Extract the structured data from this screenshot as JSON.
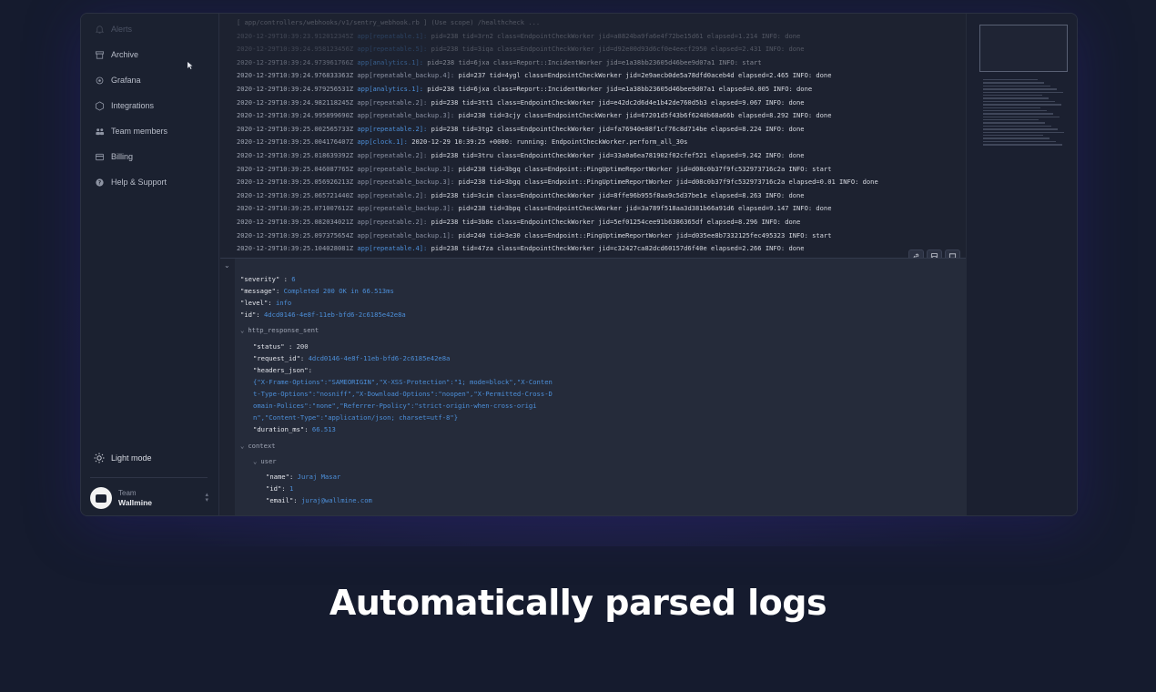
{
  "headline": "Automatically parsed logs",
  "sidebar": {
    "items": [
      {
        "label": "Alerts",
        "icon": "bell-icon",
        "dim": true
      },
      {
        "label": "Archive",
        "icon": "archive-icon",
        "dim": false
      },
      {
        "label": "Grafana",
        "icon": "grafana-icon",
        "dim": false
      },
      {
        "label": "Integrations",
        "icon": "integrations-icon",
        "dim": false
      },
      {
        "label": "Team members",
        "icon": "team-members-icon",
        "dim": false
      },
      {
        "label": "Billing",
        "icon": "billing-icon",
        "dim": false
      },
      {
        "label": "Help & Support",
        "icon": "help-icon",
        "dim": false
      }
    ],
    "light_mode": "Light mode",
    "team_label": "Team",
    "team_name": "Wallmine"
  },
  "logs": [
    {
      "ts": "",
      "app": "",
      "msg": "[ app/controllers/webhooks/v1/sentry_webhook.rb ] (Use scope) /healthcheck ...",
      "faded": true,
      "blue": false
    },
    {
      "ts": "2020-12-29T10:39:23.912012345Z",
      "app": "app[repeatable.1]:",
      "msg": "pid=238 tid=3rn2 class=EndpointCheckWorker jid=a8824ba9fa6e4f72be15d61 elapsed=1.214 INFO: done",
      "faded": true,
      "blue": true
    },
    {
      "ts": "2020-12-29T10:39:24.958123456Z",
      "app": "app[repeatable.5]:",
      "msg": "pid=238 tid=3iqa class=EndpointCheckWorker jid=d92e00d93d6cf0e4eecf2950 elapsed=2.431 INFO: done",
      "faded": true,
      "blue": true
    },
    {
      "ts": "2020-12-29T10:39:24.973961766Z",
      "app": "app[analytics.1]:",
      "msg": "pid=238 tid=6jxa class=Report::IncidentWorker jid=e1a38bb23605d46bee9d07a1 INFO: start",
      "faded": false,
      "semi": true,
      "blue": true
    },
    {
      "ts": "2020-12-29T10:39:24.976833363Z",
      "app": "app[repeatable_backup.4]:",
      "msg": "pid=237 tid=4ygl class=EndpointCheckWorker jid=2e9aecb0de5a78dfd0aceb4d elapsed=2.465 INFO: done",
      "faded": false,
      "blue": false
    },
    {
      "ts": "2020-12-29T10:39:24.979256531Z",
      "app": "app[analytics.1]:",
      "msg": "pid=238 tid=6jxa class=Report::IncidentWorker jid=e1a38bb23605d46bee9d07a1 elapsed=0.005 INFO: done",
      "faded": false,
      "blue": true
    },
    {
      "ts": "2020-12-29T10:39:24.982118245Z",
      "app": "app[repeatable.2]:",
      "msg": "pid=238 tid=3tt1 class=EndpointCheckWorker jid=e42dc2d6d4e1b42de760d5b3 elapsed=9.067 INFO: done",
      "faded": false,
      "blue": false
    },
    {
      "ts": "2020-12-29T10:39:24.995899690Z",
      "app": "app[repeatable_backup.3]:",
      "msg": "pid=238 tid=3cjy class=EndpointCheckWorker jid=67201d5f43b6f6240b68a66b elapsed=8.292 INFO: done",
      "faded": false,
      "blue": false
    },
    {
      "ts": "2020-12-29T10:39:25.002565733Z",
      "app": "app[repeatable.2]:",
      "msg": "pid=238 tid=3tg2 class=EndpointCheckWorker jid=fa76940e88f1cf76c8d714be elapsed=8.224 INFO: done",
      "faded": false,
      "blue": true
    },
    {
      "ts": "2020-12-29T10:39:25.004176407Z",
      "app": "app[clock.1]:",
      "msg": "2020-12-29 10:39:25 +0000: running: EndpointCheckWorker.perform_all_30s",
      "faded": false,
      "blue": true
    },
    {
      "ts": "2020-12-29T10:39:25.018639392Z",
      "app": "app[repeatable.2]:",
      "msg": "pid=238 tid=3tru class=EndpointCheckWorker jid=33a0a6ea781902f02cfef521 elapsed=9.242 INFO: done",
      "faded": false,
      "blue": false
    },
    {
      "ts": "2020-12-29T10:39:25.046087765Z",
      "app": "app[repeatable_backup.3]:",
      "msg": "pid=238 tid=3bgq class=Endpoint::PingUptimeReportWorker jid=d08c0b37f9fc532973716c2a INFO: start",
      "faded": false,
      "blue": false
    },
    {
      "ts": "2020-12-29T10:39:25.056926213Z",
      "app": "app[repeatable_backup.3]:",
      "msg": "pid=238 tid=3bgq class=Endpoint::PingUptimeReportWorker jid=d08c0b37f9fc532973716c2a elapsed=0.01 INFO: done",
      "faded": false,
      "blue": false
    },
    {
      "ts": "2020-12-29T10:39:25.065721440Z",
      "app": "app[repeatable.2]:",
      "msg": "pid=238 tid=3cim class=EndpointCheckWorker jid=8ffe96b955f8aa9c5d37be1e elapsed=8.263 INFO: done",
      "faded": false,
      "blue": false
    },
    {
      "ts": "2020-12-29T10:39:25.071007612Z",
      "app": "app[repeatable_backup.3]:",
      "msg": "pid=238 tid=3bpq class=EndpointCheckWorker jid=3a789f518aa3d381b66a91d6 elapsed=9.147 INFO: done",
      "faded": false,
      "blue": false
    },
    {
      "ts": "2020-12-29T10:39:25.082034021Z",
      "app": "app[repeatable.2]:",
      "msg": "pid=238 tid=3b8e class=EndpointCheckWorker jid=5ef01254cee91b6386365df elapsed=8.296 INFO: done",
      "faded": false,
      "blue": false
    },
    {
      "ts": "2020-12-29T10:39:25.097375654Z",
      "app": "app[repeatable_backup.1]:",
      "msg": "pid=240 tid=3e30 class=Endpoint::PingUptimeReportWorker jid=d035ee8b7332125fec495323 INFO: start",
      "faded": false,
      "blue": false
    },
    {
      "ts": "2020-12-29T10:39:25.104028081Z",
      "app": "app[repeatable.4]:",
      "msg": "pid=238 tid=47za class=EndpointCheckWorker jid=c32427ca82dcd60157d6f40e elapsed=2.266 INFO: done",
      "faded": false,
      "blue": true
    }
  ],
  "toolbar": {
    "link_icon": "link-icon",
    "save_icon": "save-icon",
    "comment_icon": "comment-icon"
  },
  "detail": {
    "severity_key": "\"severity\" :",
    "severity_val": "6",
    "message_key": "\"message\":",
    "message_val": "Completed 200 OK in 66.513ms",
    "level_key": "\"level\":",
    "level_val": "info",
    "id_key": "\"id\":",
    "id_val": "4dcd0146-4e8f-11eb-bfd6-2c6185e42e8a",
    "http_section": "http_response_sent",
    "status_key": "\"status\" :",
    "status_val": "200",
    "request_id_key": "\"request_id\":",
    "request_id_val": "4dcd0146-4e8f-11eb-bfd6-2c6185e42e8a",
    "headers_key": "\"headers_json\":",
    "headers_lines": [
      "{\"X-Frame-Options\":\"SAMEORIGIN\",\"X-XSS-Protection\":\"1; mode=block\",\"X-Conten",
      "t-Type-Options\":\"nosniff\",\"X-Download-Options\":\"noopen\",\"X-Permitted-Cross-D",
      "omain-Polices\":\"none\",\"Referrer-Ppolicy\":\"strict-origin-when-cross-origi",
      "n\",\"Content-Type\":\"application/json; charset=utf-8\"}"
    ],
    "duration_key": "\"duration_ms\":",
    "duration_val": "66.513",
    "context_section": "context",
    "user_section": "user",
    "name_key": "\"name\":",
    "name_val": "Juraj Masar",
    "uid_key": "\"id\":",
    "uid_val": "1",
    "email_key": "\"email\":",
    "email_val": "juraj@wallmine.com"
  }
}
